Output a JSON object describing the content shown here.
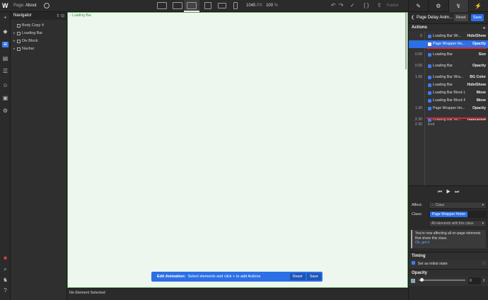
{
  "topbar": {
    "logo": "W",
    "page_prefix": "Page:",
    "page_name": "About",
    "width_value": "1045",
    "width_unit": "PX",
    "zoom_value": "100",
    "zoom_unit": "%",
    "publish_label": "Publish"
  },
  "right_tabs": [
    "brush-icon",
    "gear-icon",
    "interactions-icon",
    "lightning-icon"
  ],
  "navigator": {
    "title": "Navigator",
    "items": [
      {
        "label": "Body Copy 4",
        "has_caret": false
      },
      {
        "label": "Loading Bar",
        "has_caret": true
      },
      {
        "label": "Div Block",
        "has_caret": true
      },
      {
        "label": "Navbar",
        "has_caret": true
      }
    ]
  },
  "canvas": {
    "element_label": "Loading Bar"
  },
  "status": {
    "text": "No Element Selected"
  },
  "edit_bar": {
    "title": "Edit Animation:",
    "message": "Select elements and click + to add Actions",
    "reset_label": "Reset",
    "save_label": "Save"
  },
  "panel": {
    "title": "Page Delay Anim...",
    "reset_label": "Reset",
    "save_label": "Save",
    "actions_title": "Actions",
    "actions": [
      {
        "time": "0",
        "name": "Loading Bar Wr...",
        "type": "Hide/Show",
        "selected": false
      },
      {
        "time": "",
        "name": "Page Wrapper Ho...",
        "type": "Opacity",
        "selected": true
      },
      {
        "time": "0.00",
        "name": "Loading Bar",
        "type": "Size",
        "selected": false
      },
      {
        "time": "0.50",
        "name": "Loading Bar",
        "type": "Opacity",
        "selected": false
      },
      {
        "time": "1.00",
        "name": "Loading Bar Wra...",
        "type": "BG Color",
        "selected": false
      },
      {
        "time": "",
        "name": "Loading Bar",
        "type": "Hide/Show",
        "selected": false
      },
      {
        "time": "",
        "name": "Loading Bar Block Left",
        "type": "Move",
        "selected": false
      },
      {
        "time": "",
        "name": "Loading Bar Block Ri...",
        "type": "Move",
        "selected": false
      },
      {
        "time": "1.30",
        "name": "Page Wrapper Ho...",
        "type": "Opacity",
        "selected": false
      },
      {
        "time": "2.30",
        "name": "Loading Bar Wr...",
        "type": "Hide/Show",
        "selected": false
      }
    ],
    "end_time": "2.30",
    "end_label": "End",
    "affect_label": "Affect:",
    "affect_value": "Class",
    "class_label": "Class:",
    "class_value": "Page Wrapper Home",
    "scope_value": "All elements with this class",
    "notice_text": "You're now affecting all on-page elements that share this class.",
    "notice_link": "Ok, got it",
    "timing_title": "Timing",
    "initial_state_label": "Set as initial state",
    "opacity_title": "Opacity",
    "opacity_value": "0"
  }
}
